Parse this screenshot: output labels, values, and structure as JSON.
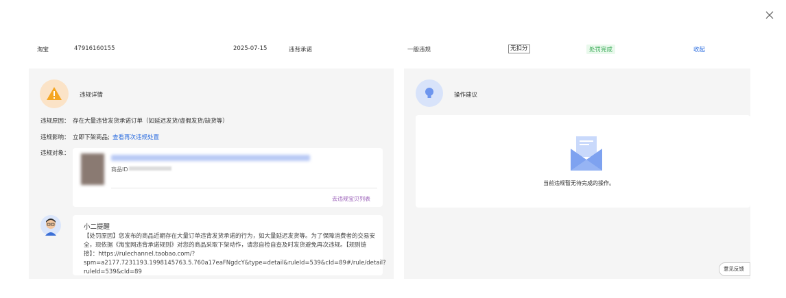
{
  "dialog": {
    "close_icon": "close-icon"
  },
  "summary": {
    "platform": "淘宝",
    "order_id": "47916160155",
    "date": "2025-07-15",
    "violation_type": "违背承诺",
    "level": "一般违规",
    "points": "无扣分",
    "status": "处罚完成",
    "collapse_label": "收起"
  },
  "violation": {
    "title": "违规详情",
    "reason_label": "违规原因：",
    "reason_text": "存在大量违背发货承诺订单（如延迟发货/虚假发货/缺货等）",
    "impact_label": "违规影响：",
    "impact_text": "立即下架商品;",
    "impact_link": "查看再次违规处置",
    "object_label": "违规对象：",
    "product_id_label": "商品ID",
    "goods_list_link": "去违规宝贝列表"
  },
  "tip": {
    "title": "小二提醒",
    "text": "【处罚原因】您发布的商品近期存在大量订单违背发货承诺的行为，如大量延迟发货等。为了保障消费者的交易安全，现依据《淘宝网违背承诺规则》对您的商品采取下架动作，请您自检自查及时发货避免再次违规。【规则链接】：https://rulechannel.taobao.com/?spm=a2177.7231193.1998145763.5.760a17eaFNgdcY&type=detail&ruleId=539&cId=89#/rule/detail?ruleId=539&cId=89"
  },
  "suggestion": {
    "title": "操作建议",
    "empty_text": "当前违规暂无待完成的操作。"
  },
  "feedback_label": "意见反馈",
  "colors": {
    "accent": "#2f6fe0",
    "warning": "#f5a623",
    "success": "#35a853"
  }
}
